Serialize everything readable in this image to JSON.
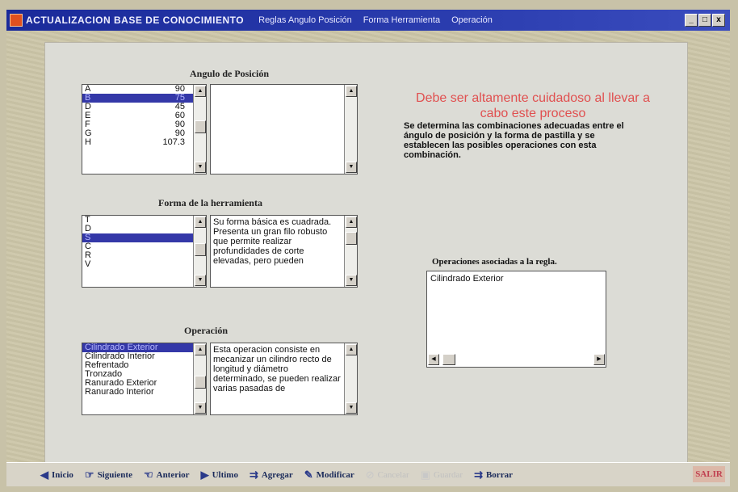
{
  "window": {
    "title": "ACTUALIZACION  BASE DE CONOCIMIENTO",
    "menu": [
      "Reglas Angulo Posición",
      "Forma Herramienta",
      "Operación"
    ],
    "controls": {
      "minimize": "_",
      "maximize": "□",
      "close": "x"
    }
  },
  "angulo": {
    "title": "Angulo de Posición",
    "items": [
      {
        "code": "A",
        "value": "90"
      },
      {
        "code": "B",
        "value": "75"
      },
      {
        "code": "D",
        "value": "45"
      },
      {
        "code": "E",
        "value": "60"
      },
      {
        "code": "F",
        "value": "90"
      },
      {
        "code": "G",
        "value": "90"
      },
      {
        "code": "H",
        "value": "107.3"
      }
    ],
    "selected_index": 1
  },
  "forma": {
    "title": "Forma de la herramienta",
    "items": [
      "T",
      "D",
      "S",
      "C",
      "R",
      "V"
    ],
    "selected_index": 2,
    "description": "Su forma básica es cuadrada. Presenta un gran filo robusto que permite realizar profundidades de corte elevadas, pero pueden"
  },
  "operacion": {
    "title": "Operación",
    "items": [
      "Cilindrado Exterior",
      "Cilindrado Interior",
      "Refrentado",
      "Tronzado",
      "Ranurado Exterior",
      "Ranurado Interior"
    ],
    "selected_index": 0,
    "description": "Esta operacion consiste en mecanizar un cilindro recto de longitud y diámetro determinado, se pueden realizar varias pasadas de"
  },
  "warning": "Debe ser altamente cuidadoso al llevar a cabo este proceso",
  "info": "Se determina las combinaciones adecuadas entre el ángulo de posición y la forma de pastilla y se establecen las posibles operaciones con esta combinación.",
  "ops_assoc": {
    "title": "Operaciones asociadas a la regla.",
    "items": [
      "Cilindrado Exterior"
    ]
  },
  "toolbar": {
    "buttons": [
      {
        "label": "Inicio",
        "icon": "arrow-left-icon",
        "glyph": "◀",
        "enabled": true
      },
      {
        "label": "Siguiente",
        "icon": "pointing-hand-right-icon",
        "glyph": "☞",
        "enabled": true
      },
      {
        "label": "Anterior",
        "icon": "pointing-hand-left-icon",
        "glyph": "☜",
        "enabled": true
      },
      {
        "label": "Ultimo",
        "icon": "arrow-right-icon",
        "glyph": "▶",
        "enabled": true
      },
      {
        "label": "Agregar",
        "icon": "add-record-icon",
        "glyph": "⇉",
        "enabled": true
      },
      {
        "label": "Modificar",
        "icon": "modify-icon",
        "glyph": "✎",
        "enabled": true
      },
      {
        "label": "Cancelar",
        "icon": "cancel-icon",
        "glyph": "⊘",
        "enabled": false
      },
      {
        "label": "Guardar",
        "icon": "save-icon",
        "glyph": "▣",
        "enabled": false
      },
      {
        "label": "Borrar",
        "icon": "delete-icon",
        "glyph": "⇉",
        "enabled": true
      }
    ],
    "exit": "SALIR"
  },
  "colors": {
    "titlebar": "#1a2a9a",
    "selection": "#3438a8",
    "warning": "#e05050",
    "exit_button": "#dcb8a8"
  }
}
